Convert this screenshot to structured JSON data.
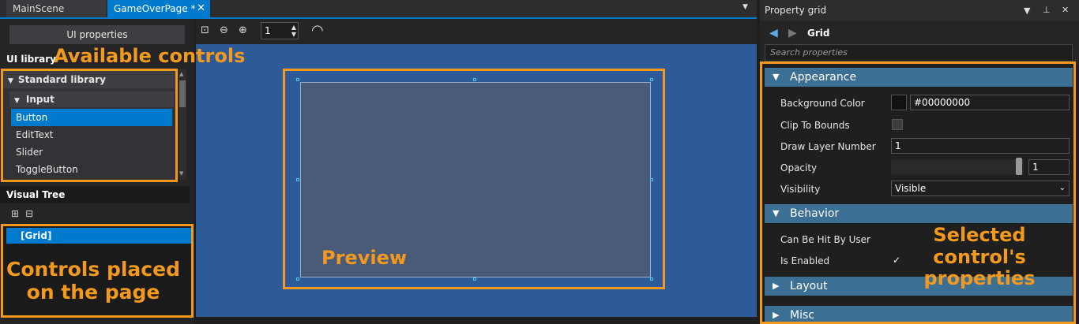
{
  "tabs": {
    "main_scene": "MainScene",
    "game_over_page": "GameOverPage *",
    "close_glyph": "✕"
  },
  "left_panel": {
    "ui_properties_button": "UI properties",
    "ui_library_title": "UI library",
    "standard_library": "Standard library",
    "input_group": "Input",
    "items": [
      "Button",
      "EditText",
      "Slider",
      "ToggleButton"
    ],
    "selected_item": "Button",
    "visual_tree_title": "Visual Tree",
    "tree_root": "[Grid]"
  },
  "center_panel": {
    "zoom_value": "1"
  },
  "property_grid": {
    "title": "Property grid",
    "element_name": "Grid",
    "search_placeholder": "Search properties",
    "categories": {
      "appearance": "Appearance",
      "behavior": "Behavior",
      "layout": "Layout",
      "misc": "Misc"
    },
    "props": {
      "background_color_label": "Background Color",
      "background_color_value": "#00000000",
      "clip_to_bounds_label": "Clip To Bounds",
      "draw_layer_label": "Draw Layer Number",
      "draw_layer_value": "1",
      "opacity_label": "Opacity",
      "opacity_value": "1",
      "visibility_label": "Visibility",
      "visibility_value": "Visible",
      "can_be_hit_label": "Can Be Hit By User",
      "is_enabled_label": "Is Enabled"
    },
    "clip_to_bounds_checked": false,
    "is_enabled_checked": true
  },
  "annotations": {
    "available_controls": "Available controls",
    "controls_placed_line1": "Controls placed",
    "controls_placed_line2": "on the page",
    "preview": "Preview",
    "selected_props_line1": "Selected control's",
    "selected_props_line2": "properties",
    "color": "#f39a1e"
  },
  "colors": {
    "accent": "#007acc",
    "canvas": "#2d5a98",
    "category_header": "#3b6f93"
  }
}
